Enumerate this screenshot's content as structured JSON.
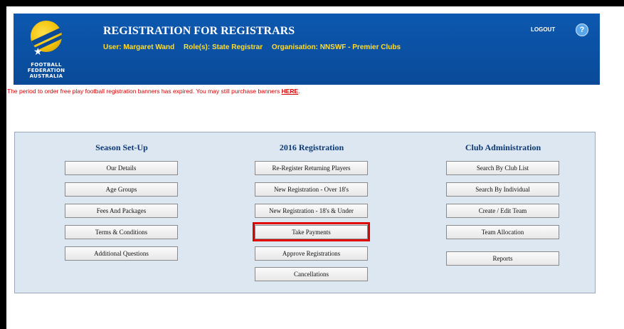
{
  "header": {
    "title": "REGISTRATION FOR REGISTRARS",
    "user": "User: Margaret Wand",
    "role": "Role(s): State Registrar",
    "organisation": "Organisation: NNSWF - Premier Clubs",
    "logout_label": "LOGOUT",
    "help_label": "?",
    "logo_lines": [
      "FOOTBALL",
      "FEDERATION",
      "AUSTRALIA"
    ]
  },
  "notice": {
    "text": "The period to order free play football registration banners has expired. You may still purchase banners ",
    "link": "HERE",
    "suffix": "."
  },
  "columns": [
    {
      "title": "Season Set-Up",
      "buttons": [
        "Our Details",
        "Age Groups",
        "Fees And Packages",
        "Terms & Conditions",
        "Additional Questions"
      ]
    },
    {
      "title": "2016 Registration",
      "buttons": [
        "Re-Register Returning Players",
        "New Registration - Over 18's",
        "New Registration - 18's & Under",
        "Take Payments",
        "Approve Registrations",
        "Cancellations"
      ]
    },
    {
      "title": "Club Administration",
      "buttons": [
        "Search By Club List",
        "Search By Individual",
        "Create / Edit Team",
        "Team Allocation",
        "Reports"
      ]
    }
  ],
  "highlighted_button": "Take Payments",
  "colors": {
    "header_bg": "#0a4fa0",
    "user_text": "#ffdd33",
    "notice_text": "#d20000",
    "panel_bg": "#dde7f2",
    "highlight": "#e10000"
  }
}
